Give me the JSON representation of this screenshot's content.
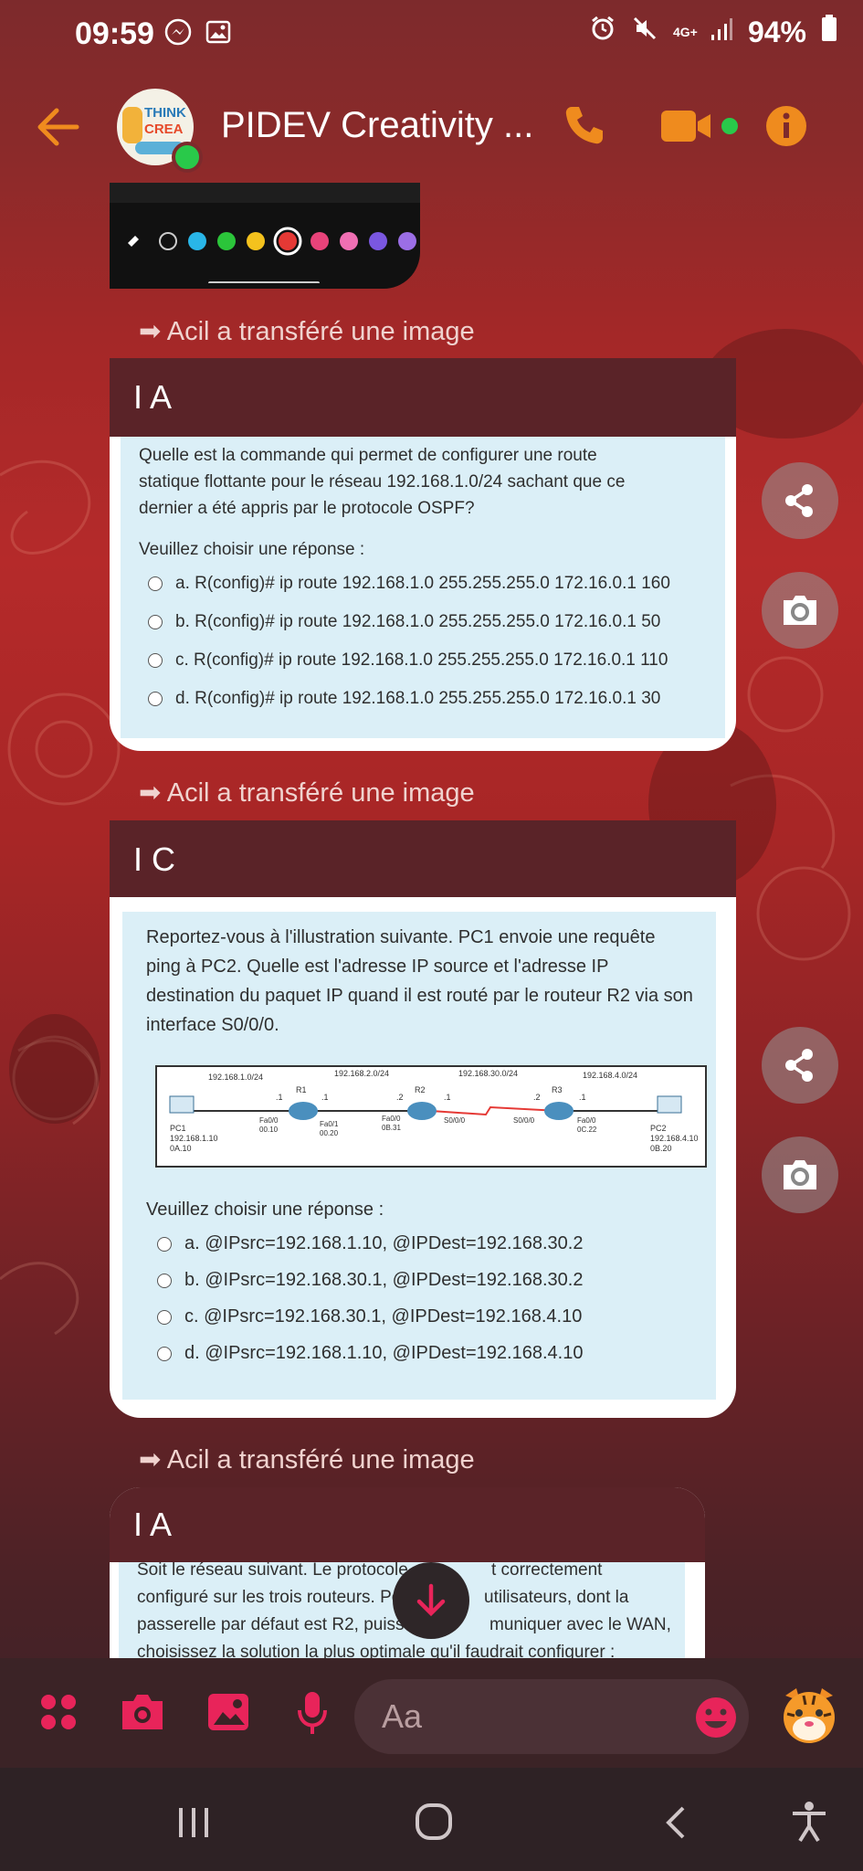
{
  "status_bar": {
    "time": "09:59",
    "network": "4G+",
    "battery": "94%"
  },
  "header": {
    "title": "PIDEV Creativity ...",
    "avatar_text_1": "THINK",
    "avatar_text_2": "CREA"
  },
  "transfers": [
    {
      "text": "Acil a transféré une image"
    },
    {
      "text": "Acil a transféré une image"
    },
    {
      "text": "Acil a transféré une image"
    }
  ],
  "messages": [
    {
      "header": "I  A",
      "question": "Quelle est la commande qui permet de configurer une route statique flottante pour le réseau 192.168.1.0/24 sachant que ce dernier a été appris par le protocole OSPF?",
      "prompt": "Veuillez choisir une réponse :",
      "options": [
        "a. R(config)# ip route 192.168.1.0 255.255.255.0 172.16.0.1 160",
        "b. R(config)# ip route 192.168.1.0 255.255.255.0 172.16.0.1 50",
        "c. R(config)# ip route 192.168.1.0 255.255.255.0 172.16.0.1 110",
        "d. R(config)# ip route 192.168.1.0 255.255.255.0 172.16.0.1 30"
      ]
    },
    {
      "header": "I  C",
      "question": "Reportez-vous à l'illustration suivante. PC1 envoie une requête ping à PC2. Quelle est l'adresse IP source et l'adresse IP destination du paquet IP quand il est routé par le routeur R2 via son interface S0/0/0.",
      "prompt": "Veuillez choisir une réponse :",
      "options": [
        "a. @IPsrc=192.168.1.10, @IPDest=192.168.30.2",
        "b. @IPsrc=192.168.30.1, @IPDest=192.168.30.2",
        "c. @IPsrc=192.168.30.1, @IPDest=192.168.4.10",
        "d. @IPsrc=192.168.1.10, @IPDest=192.168.4.10"
      ],
      "diagram": {
        "networks": [
          "192.168.1.0/24",
          "192.168.2.0/24",
          "192.168.30.0/24",
          "192.168.4.0/24"
        ],
        "routers": [
          "R1",
          "R2",
          "R3"
        ],
        "pc1": {
          "name": "PC1",
          "ip": "192.168.1.10",
          "mac": "0A.10"
        },
        "pc2": {
          "name": "PC2",
          "ip": "192.168.4.10",
          "mac": "0B.20"
        },
        "ifaces": [
          "Fa0/0",
          "00.10",
          "Fa0/1",
          "00.20",
          "Fa0/0",
          "0B.31",
          "S0/0/0",
          "S0/0/0",
          "Fa0/0",
          "0C.22"
        ],
        "dots": [
          ".1",
          ".1",
          ".2",
          ".1",
          ".2",
          ".1"
        ]
      }
    },
    {
      "header": "I  A",
      "question": "Soit le réseau suivant. Le protocole ... est correctement configuré sur les trois routeurs. Pour ... utilisateurs, dont la passerelle par défaut est R2, puissent communiquer avec le WAN, choisissez la solution la plus optimale qu'il faudrait configurer :",
      "q_line1": "Soit le réseau suivant. Le protocole",
      "q_line1b": "t correctement",
      "q_line2": "configuré sur les trois routeurs. Po",
      "q_line2b": "utilisateurs, dont la",
      "q_line3": "passerelle par défaut est R2, puisser",
      "q_line3b": "muniquer avec le WAN,",
      "q_line4": "choisissez la solution la plus optimale qu'il faudrait configurer :"
    }
  ],
  "composer": {
    "placeholder": "Aa"
  },
  "colors": {
    "accent": "#ef8b1e",
    "pink": "#e8245a",
    "header_bg": "#5a2328",
    "quiz_bg": "#dbeff7"
  }
}
